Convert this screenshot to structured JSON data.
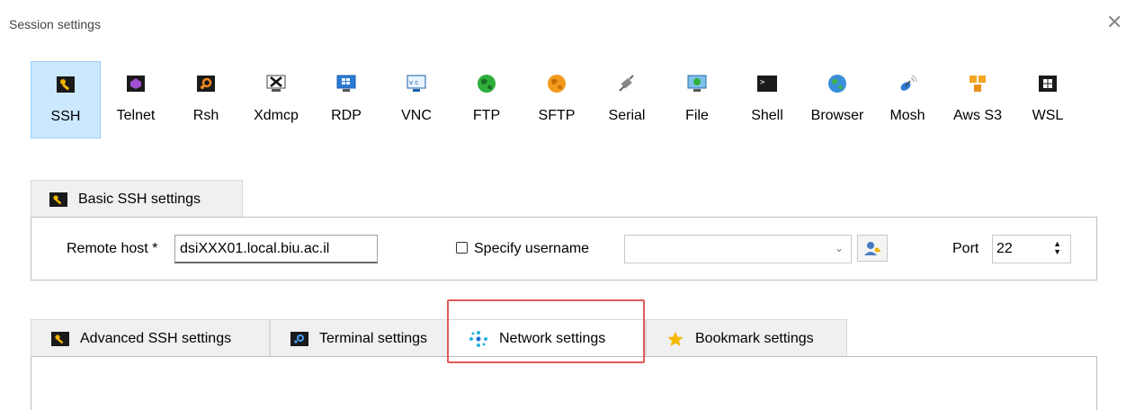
{
  "window": {
    "title": "Session settings",
    "close_glyph": "✕"
  },
  "protocols": [
    {
      "label": "SSH",
      "icon": "ssh-key-icon",
      "selected": true
    },
    {
      "label": "Telnet",
      "icon": "telnet-icon"
    },
    {
      "label": "Rsh",
      "icon": "rsh-icon"
    },
    {
      "label": "Xdmcp",
      "icon": "xdmcp-icon"
    },
    {
      "label": "RDP",
      "icon": "rdp-monitor-icon"
    },
    {
      "label": "VNC",
      "icon": "vnc-icon"
    },
    {
      "label": "FTP",
      "icon": "ftp-globe-icon"
    },
    {
      "label": "SFTP",
      "icon": "sftp-globe-icon"
    },
    {
      "label": "Serial",
      "icon": "serial-plug-icon"
    },
    {
      "label": "File",
      "icon": "file-monitor-icon"
    },
    {
      "label": "Shell",
      "icon": "shell-terminal-icon"
    },
    {
      "label": "Browser",
      "icon": "browser-globe-icon"
    },
    {
      "label": "Mosh",
      "icon": "mosh-satellite-icon"
    },
    {
      "label": "Aws S3",
      "icon": "aws-s3-cubes-icon"
    },
    {
      "label": "WSL",
      "icon": "wsl-windows-icon"
    }
  ],
  "basic_tab": {
    "label": "Basic SSH settings"
  },
  "basic": {
    "remote_host_label": "Remote host *",
    "remote_host_value": "dsiXXX01.local.biu.ac.il",
    "specify_username_label": "Specify username",
    "username_value": "",
    "port_label": "Port",
    "port_value": "22"
  },
  "lower_tabs": [
    {
      "label": "Advanced SSH settings",
      "icon": "key-icon"
    },
    {
      "label": "Terminal settings",
      "icon": "terminal-icon"
    },
    {
      "label": "Network settings",
      "icon": "network-icon",
      "active": true
    },
    {
      "label": "Bookmark settings",
      "icon": "star-icon"
    }
  ],
  "colors": {
    "selected_bg": "#cce8ff",
    "highlight": "#e05a5a"
  }
}
